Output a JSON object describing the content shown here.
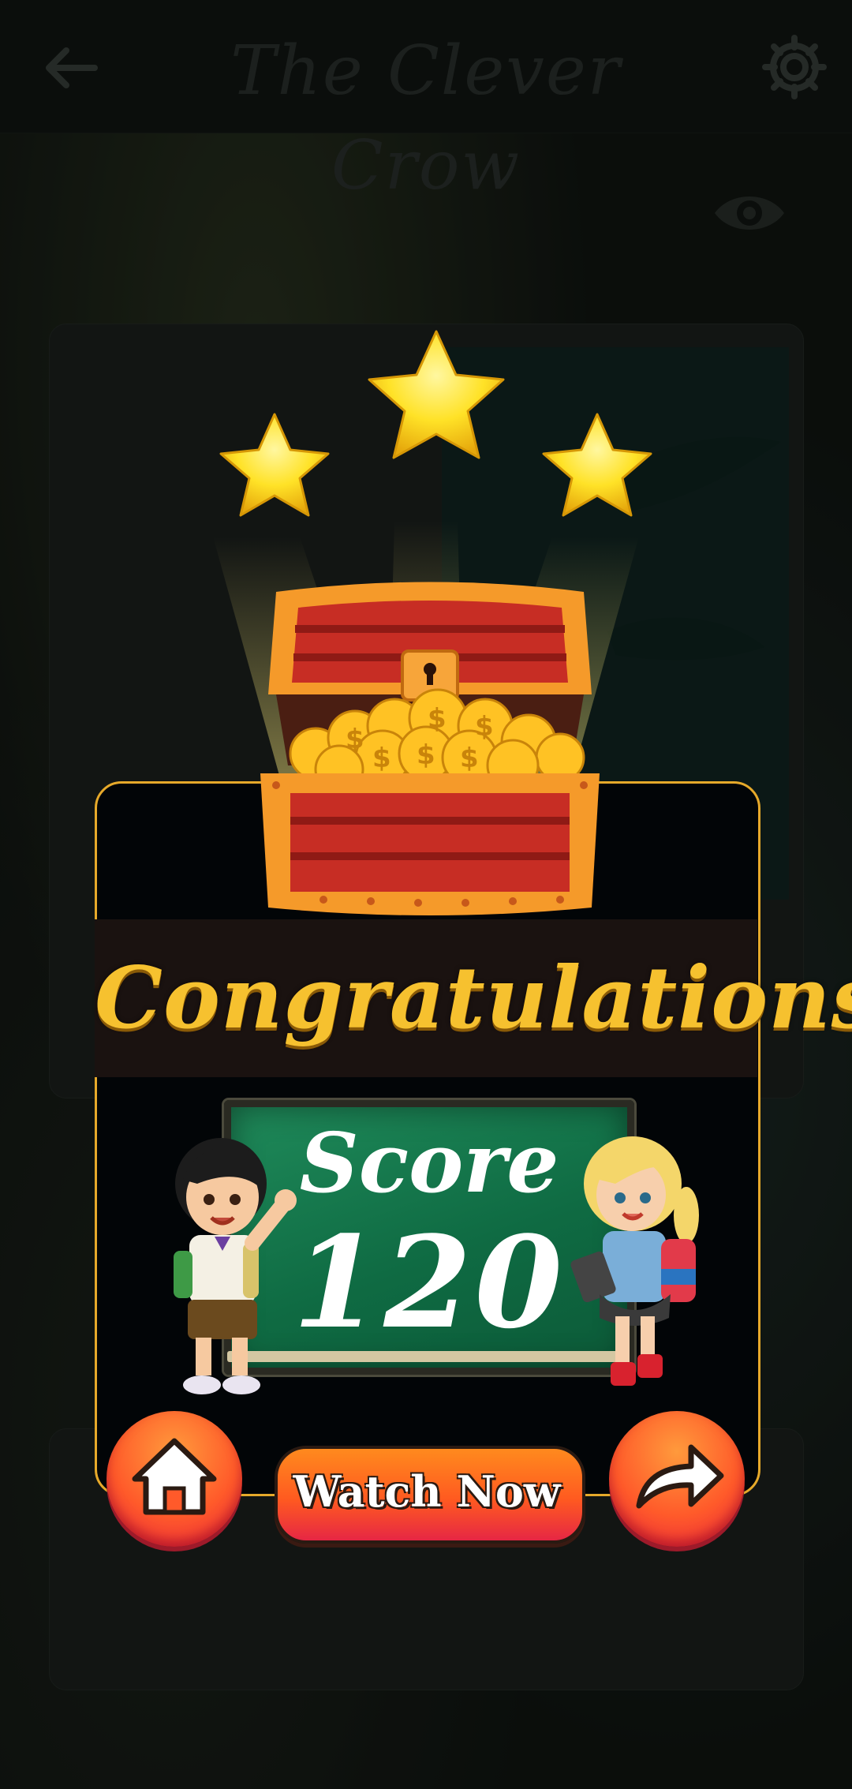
{
  "header": {
    "title": "The Clever Crow",
    "back_icon": "arrow-left-icon",
    "settings_icon": "gear-icon",
    "visibility_icon": "eye-icon"
  },
  "result": {
    "stars_earned": 3,
    "stars_total": 3,
    "headline": "Congratulations",
    "score_label": "Score",
    "score_value": "120"
  },
  "actions": {
    "home_icon": "home-icon",
    "watch_label": "Watch Now",
    "next_icon": "share-arrow-icon"
  },
  "colors": {
    "accent": "#f6c12f",
    "panel_border": "#e6a92a",
    "button_top": "#ff9a3c",
    "button_bottom": "#e8213f",
    "board": "#0f6b43"
  }
}
